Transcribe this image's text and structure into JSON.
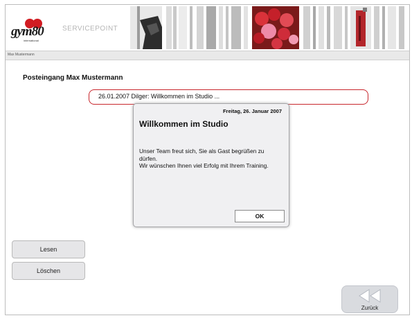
{
  "header": {
    "logo_text": "gym80",
    "logo_subtext": "international",
    "service_label": "SERVICEPOINT"
  },
  "subbar": {
    "user_label": "Max Mustermann"
  },
  "inbox": {
    "title": "Posteingang Max Mustermann",
    "messages": [
      {
        "preview": "26.01.2007 Dilger: Willkommen im Studio ..."
      }
    ]
  },
  "dialog": {
    "date": "Freitag, 26. Januar 2007",
    "title": "Willkommen im Studio",
    "body_line1": "Unser Team freut sich, Sie als Gast begrüßen zu dürfen.",
    "body_line2": "Wir wünschen Ihnen viel Erfolg mit Ihrem Training.",
    "ok_label": "OK"
  },
  "actions": {
    "read_label": "Lesen",
    "delete_label": "Löschen",
    "back_label": "Zurück"
  },
  "colors": {
    "accent_red": "#d11c22",
    "message_border": "#c8262c",
    "dialog_bg": "#f0f0f2"
  }
}
